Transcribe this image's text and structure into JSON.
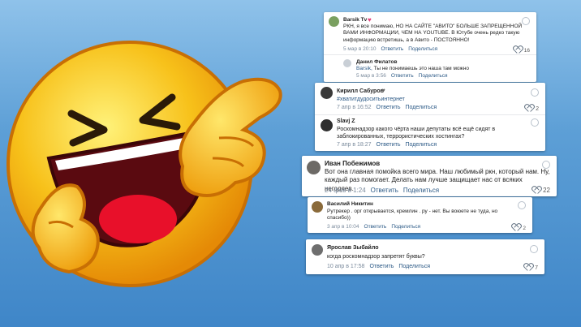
{
  "comments": {
    "c1": {
      "name": "Barsik Tv",
      "text": "РКН, я все понимаю, НО НА САЙТЕ \"АВИТО\" БОЛЬШЕ ЗАПРЕЩЕННОЙ ВАМИ ИНФОРМАЦИИ, ЧЕМ НА YOUTUBE. В Ютубе очень редко такую информацию встретишь, а в Авито - ПОСТОЯННО!",
      "date": "5 мар в 20:10",
      "reply": "Ответить",
      "share": "Поделиться",
      "likes": "16"
    },
    "c1r": {
      "name": "Данил Филатов",
      "to": "Barsik,",
      "text": " Ты не понимаешь это наша там можно",
      "date": "5 мар в 3:56",
      "reply": "Ответить",
      "share": "Поделиться"
    },
    "c2": {
      "name": "Кирилл Сабуров",
      "text": "#хватитдудоситьинтернет",
      "date": "7 апр в 16:52",
      "reply": "Ответить",
      "share": "Поделиться",
      "likes": "2"
    },
    "c3": {
      "name": "Slavj Z",
      "text": "Роскомнадзор какого чёрта наши депутаты всё ещё сидят в заблокированных, террористических хостингах?",
      "date": "7 апр в 18:27",
      "reply": "Ответить",
      "share": "Поделиться"
    },
    "c4": {
      "name": "Иван Побежимов",
      "text": "Вот она главная помойка всего мира. Наш любимый ркн, который нам. Ну, каждый раз помогает. Делать нам лучше защищает нас от всяких негодяев.",
      "date": "24 фев в 1:24",
      "reply": "Ответить",
      "share": "Поделиться",
      "likes": "22"
    },
    "c5": {
      "name": "Василий Никитин",
      "text": "Рутрекер . орг открывается, кремлин . ру - нет. Вы воюете не туда, но спасибо))",
      "date": "3 апр в 10:04",
      "reply": "Ответить",
      "share": "Поделиться",
      "likes": "2"
    },
    "c6": {
      "name": "Ярослав Зыбайло",
      "text": "когда роскомнадзор запретят буквы?",
      "date": "10 апр в 17:58",
      "reply": "Ответить",
      "share": "Поделиться",
      "likes": "7"
    }
  },
  "colors": {
    "sky": "#5d9fd6",
    "emoji": "#f7c11a",
    "link": "#2a5885"
  }
}
